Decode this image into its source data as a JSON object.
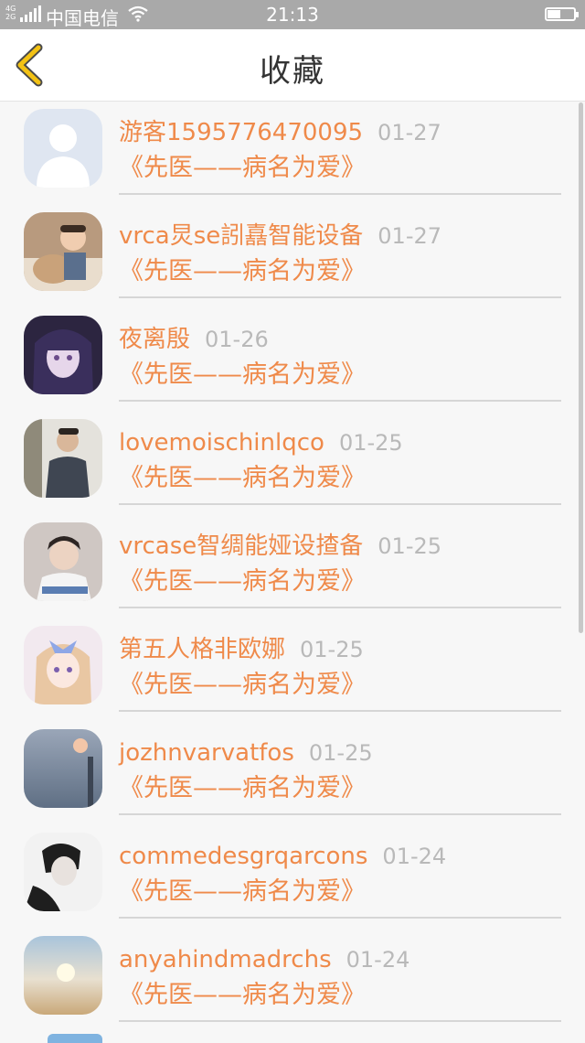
{
  "status": {
    "network_top": "4G",
    "network_bottom": "2G",
    "carrier": "中国电信",
    "time": "21:13"
  },
  "nav": {
    "title": "收藏"
  },
  "items": [
    {
      "name": "游客1595776470095",
      "date": "01-27",
      "novel": "《先医——病名为爱》"
    },
    {
      "name": "vrca炅se訠嚞智能设备",
      "date": "01-27",
      "novel": "《先医——病名为爱》"
    },
    {
      "name": "夜离殷",
      "date": "01-26",
      "novel": "《先医——病名为爱》"
    },
    {
      "name": "lovemoischinlqco",
      "date": "01-25",
      "novel": "《先医——病名为爱》"
    },
    {
      "name": "vrcase智绸能娅设揸备",
      "date": "01-25",
      "novel": "《先医——病名为爱》"
    },
    {
      "name": "第五人格非欧娜",
      "date": "01-25",
      "novel": "《先医——病名为爱》"
    },
    {
      "name": "jozhnvarvatfos",
      "date": "01-25",
      "novel": "《先医——病名为爱》"
    },
    {
      "name": "commedesgrqarcons",
      "date": "01-24",
      "novel": "《先医——病名为爱》"
    },
    {
      "name": "anyahindmadrchs",
      "date": "01-24",
      "novel": "《先医——病名为爱》"
    }
  ]
}
